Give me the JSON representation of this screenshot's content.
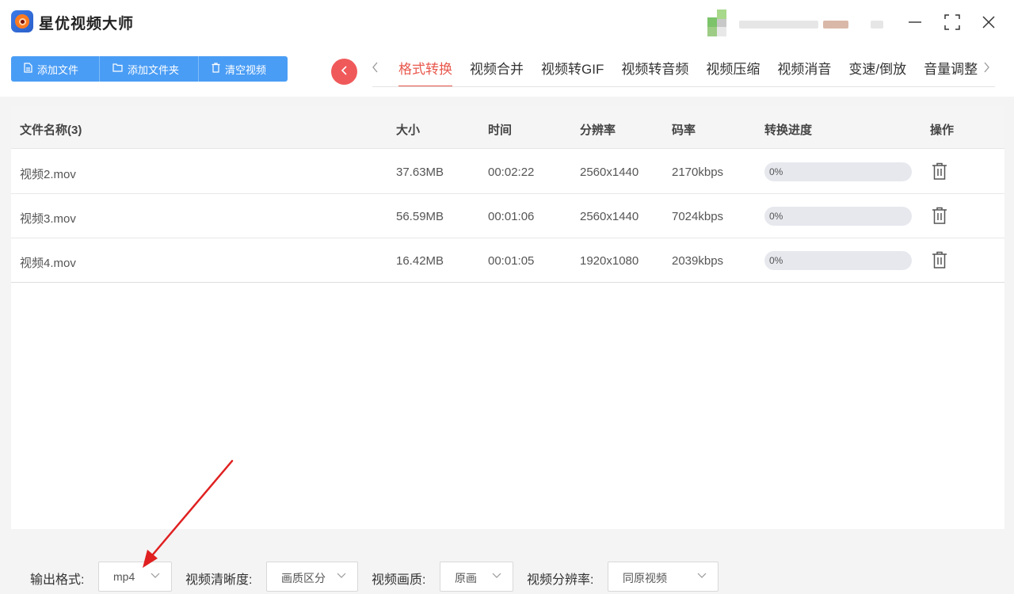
{
  "app": {
    "title": "星优视频大师"
  },
  "toolbar": {
    "add_file": "添加文件",
    "add_folder": "添加文件夹",
    "clear_videos": "清空视频"
  },
  "tabs": [
    {
      "label": "格式转换",
      "active": true
    },
    {
      "label": "视频合并"
    },
    {
      "label": "视频转GIF"
    },
    {
      "label": "视频转音频"
    },
    {
      "label": "视频压缩"
    },
    {
      "label": "视频消音"
    },
    {
      "label": "变速/倒放"
    },
    {
      "label": "音量调整"
    }
  ],
  "table": {
    "headers": {
      "name": "文件名称(3)",
      "size": "大小",
      "duration": "时间",
      "resolution": "分辨率",
      "bitrate": "码率",
      "progress": "转换进度",
      "action": "操作"
    },
    "rows": [
      {
        "name": "视频2.mov",
        "size": "37.63MB",
        "duration": "00:02:22",
        "resolution": "2560x1440",
        "bitrate": "2170kbps",
        "progress_text": "0%",
        "progress": 0
      },
      {
        "name": "视频3.mov",
        "size": "56.59MB",
        "duration": "00:01:06",
        "resolution": "2560x1440",
        "bitrate": "7024kbps",
        "progress_text": "0%",
        "progress": 0
      },
      {
        "name": "视频4.mov",
        "size": "16.42MB",
        "duration": "00:01:05",
        "resolution": "1920x1080",
        "bitrate": "2039kbps",
        "progress_text": "0%",
        "progress": 0
      }
    ]
  },
  "options": {
    "format_label": "输出格式:",
    "format_value": "mp4",
    "clarity_label": "视频清晰度:",
    "clarity_value": "画质区分",
    "quality_label": "视频画质:",
    "quality_value": "原画",
    "resolution_label": "视频分辨率:",
    "resolution_value": "同原视频"
  },
  "colors": {
    "accent_blue": "#4a9df5",
    "accent_red": "#e8584d",
    "annotation_arrow": "#e02020"
  }
}
